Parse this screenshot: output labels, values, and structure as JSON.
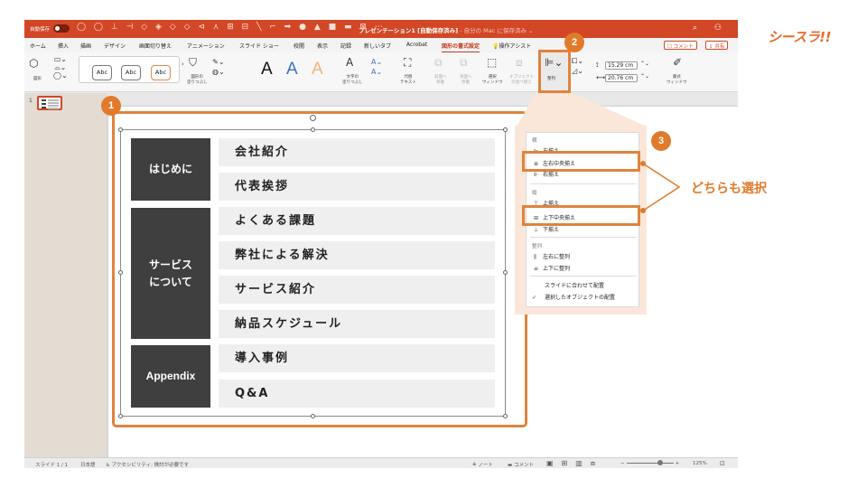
{
  "window": {
    "autosave_label": "自動保存",
    "autosave_state": "オフ",
    "title": "プレゼンテーション1 [自動保存済み]",
    "title_suffix": "- 自分の Mac に保存済み ⌄",
    "toolbar_glyphs": "◯ ◯ ⊥ ⊣ ◇ ◈ ◇ ◇ ⊲ ⋏ ⊞ ⊟ ╲ ⌐ ➡ ● ▲ ■ ▬ ⊠ ⋯",
    "right_glyphs": "⌕ ⚇"
  },
  "tabs": {
    "items": [
      "ホーム",
      "挿入",
      "描画",
      "デザイン",
      "画面切り替え",
      "アニメーション",
      "スライド ショー",
      "校閲",
      "表示",
      "記録",
      "新しいタブ",
      "Acrobat",
      "図形の書式設定",
      "操作アシスト"
    ],
    "active": "図形の書式設定",
    "comment_button": "☐ コメント",
    "share_button": "⇪ 共有"
  },
  "ribbon": {
    "shape_label": "図形",
    "style_samples": [
      "Abc",
      "Abc",
      "Abc"
    ],
    "fill_label_1": "図形の",
    "fill_label_2": "塗りつぶし",
    "wordart_letters": [
      "A",
      "A",
      "A"
    ],
    "text_fill_1": "文字の",
    "text_fill_2": "塗りつぶし",
    "alt_text_1": "代替",
    "alt_text_2": "テキスト",
    "forward_1": "前面へ",
    "forward_2": "移動",
    "backward_1": "背面へ",
    "backward_2": "移動",
    "selection_1": "選択",
    "selection_2": "ウィンドウ",
    "objects_1": "オブジェクト",
    "objects_2": "の並べ替え",
    "align_label": "整列",
    "height_value": "15.29 cm",
    "width_value": "20.76 cm",
    "format_pane_1": "書式",
    "format_pane_2": "ウィンドウ"
  },
  "thumbnails": {
    "slide_number": "1"
  },
  "slide": {
    "sections": [
      {
        "label": "はじめに",
        "items": [
          "会社紹介",
          "代表挨拶"
        ]
      },
      {
        "label": "サービス\nについて",
        "items": [
          "よくある課題",
          "弊社による解決",
          "サービス紹介",
          "納品スケジュール"
        ]
      },
      {
        "label": "Appendix",
        "items": [
          "導入事例",
          "Q&A"
        ]
      }
    ]
  },
  "menu": {
    "header_horizontal": "横",
    "left_align": "左揃え",
    "center_horizontal": "左右中央揃え",
    "right_align": "右揃え",
    "header_vertical": "縦",
    "top_align": "上揃え",
    "center_vertical": "上下中央揃え",
    "bottom_align": "下揃え",
    "header_distribute": "整列",
    "distribute_horizontal": "左右に整列",
    "distribute_vertical": "上下に整列",
    "align_to_slide": "スライドに合わせて配置",
    "align_selected": "選択したオブジェクトの配置",
    "checkmark": "✓"
  },
  "callouts": {
    "one": "1",
    "two": "2",
    "three": "3"
  },
  "annotation": "どちらも選択",
  "logo": "シースラ!!",
  "status": {
    "slide_count": "スライド 1 / 1",
    "language": "日本語",
    "accessibility": "アクセシビリティ: 検討が必要です",
    "notes": "≜ ノート",
    "comments": "▬ コメント",
    "zoom": "125%"
  },
  "colors": {
    "accent": "#d24726",
    "callout": "#e07b2c",
    "label_bg": "#3f3f3f",
    "row_bg": "#efefef"
  }
}
